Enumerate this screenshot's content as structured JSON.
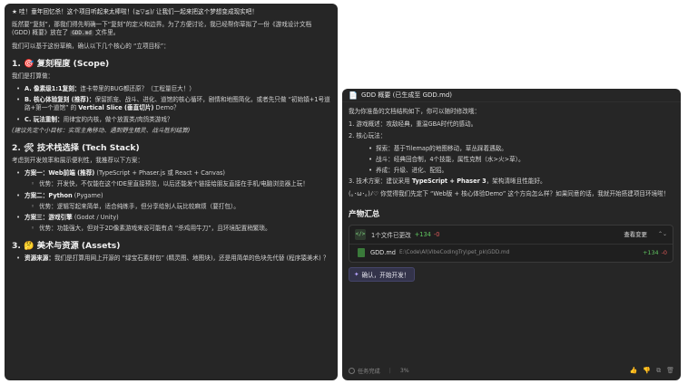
{
  "left": {
    "intro1": "★  哇！童年回忆杀！这个项目听起来太棒啦！(≧▽≦)/ 让我们一起来把这个梦想变成现实吧！",
    "intro2_a": "既然要“复刻”，那我们得先明确一下“复刻”的定义和边界。为了方便讨论，我已经帮你草拟了一份《游戏设计文档 (GDD) 概要》放在了",
    "intro2_code": "GDD.md",
    "intro2_b": "文件里。",
    "intro3": "我们可以基于这份草稿，确认以下几个核心的 “立项目标”：",
    "s1_title": "1. 🎯 复刻程度 (Scope)",
    "s1_lead": "我们是打算做：",
    "s1_items": [
      {
        "bold": "A. 像素级1:1复刻：",
        "text": "连卡带里的BUG都还原？（工程量巨大！）"
      },
      {
        "bold": "B. 核心体验复刻 (推荐)：",
        "text": "保留抓宠、战斗、进化、道馆的核心循环，剧情和地图简化，或者先只做 “初始镇+1号道路+第一个道馆” 的 ",
        "bold2": "Vertical Slice (垂直切片)",
        "tail": " Demo？"
      },
      {
        "bold": "C. 玩法重制：",
        "text": "用律宝的内核，做个放置类/肉鸽类游戏？"
      }
    ],
    "s1_note": "(建议先定个小目标：实现主角移动、遇到野生精灵、战斗胜利结算)",
    "s2_title": "2. 🛠 技术栈选择 (Tech Stack)",
    "s2_lead": "考虑到开发效率和展示便利性，我推荐以下方案：",
    "s2_opt1_bold": "方案一：Web前端 (推荐)",
    "s2_opt1_text": " (TypeScript + Phaser.js 或 React + Canvas)",
    "s2_opt1_sub": "优势：开发快，不仅能在这个IDE里直接预览，以后还能发个链接给朋友直接在手机/电脑浏览器上玩！",
    "s2_opt2_bold": "方案二：Python",
    "s2_opt2_text": " (Pygame)",
    "s2_opt2_sub": "优势：逻辑写起来简单，适合纯练手，但分享给别人玩比较麻烦（要打包）。",
    "s2_opt3_bold": "方案三：游戏引擎",
    "s2_opt3_text": " (Godot / Unity)",
    "s2_opt3_sub": "优势：功能强大，但对于2D像素游戏来说可能有点 “杀鸡用牛刀”，且环境配置稍繁琐。",
    "s3_title": "3. 🤔 美术与资源 (Assets)",
    "s3_item_bold": "资源来源：",
    "s3_item_text": "我们是打算用网上开源的 “绿宝石素材包” (精灵图、地图块)，还是用简单的色块先代替 (程序猿美术) ？"
  },
  "right": {
    "header": "GDD 概要 (已生成至 GDD.md)",
    "lead": "我为你准备的文档结构如下，你可以随时修改哦：",
    "l1": "1. 游戏概述：攻敌经典，重温GBA时代的感动。",
    "l2": "2. 核心玩法：",
    "l2_items": [
      "探索：基于Tilemap的地图移动，草丛踩着遇敌。",
      "战斗：经典回合制，4个技能，属性克制（水>火>草）。",
      "养成：升级、进化、配招。"
    ],
    "l3_a": "3. 技术方案：建议采用 ",
    "l3_bold": "TypeScript + Phaser 3",
    "l3_b": "，架构清晰且性能好。",
    "closing": "(｡･ω･｡)ﾉ♡ 你觉得我们先定下 “Web版 + 核心体验Demo” 这个方向怎么样？如果同意的话，我就开始搭建项目环境啦！",
    "product_title": "产物汇总",
    "changes_label": "1个文件已更改",
    "changes_add": "+134",
    "changes_del": "-0",
    "view_changes": "查看变更",
    "file_name": "GDD.md",
    "file_path": "E:\\Code\\AI\\VibeCodingTry\\pet_pk\\GDD.md",
    "file_add": "+134",
    "file_del": "-0",
    "confirm_btn": "确认，开始开发！",
    "footer_status": "任务完成",
    "footer_pct": "3%"
  }
}
